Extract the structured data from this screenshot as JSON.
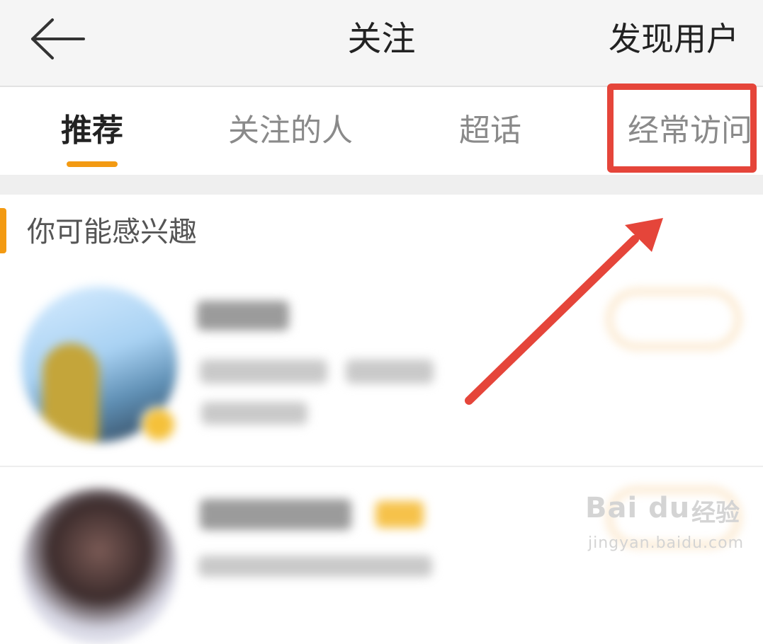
{
  "header": {
    "back_icon": "arrow-left-icon",
    "title": "关注",
    "discover_label": "发现用户"
  },
  "tabs": [
    {
      "label": "推荐",
      "active": true
    },
    {
      "label": "关注的人",
      "active": false
    },
    {
      "label": "超话",
      "active": false
    },
    {
      "label": "经常访问",
      "active": false
    }
  ],
  "section": {
    "title": "你可能感兴趣"
  },
  "colors": {
    "accent": "#f39a12",
    "highlight": "#e5453a",
    "header_bg": "#f5f5f5",
    "separator": "#efefef"
  },
  "watermark": {
    "logo": "Bai du",
    "brand": "经验",
    "url": "jingyan.baidu.com"
  }
}
